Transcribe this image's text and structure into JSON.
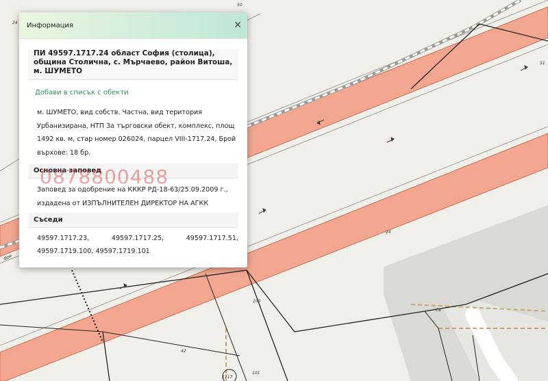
{
  "popup": {
    "title": "Информация",
    "close_icon": "close-icon",
    "parcel_title": "ПИ 49597.1717.24 област София (столица), община Столична, с. Мърчаево, район Витоша, м. ШУМЕТО",
    "add_link": "Добави в списък с обекти",
    "description_lines": [
      "м. ШУМЕТО, вид собств. Частна, вид територия",
      "Урбанизирана, НТП За търговски обект, комплекс, площ",
      "1492 кв. м, стар номер 026024, парцел VIII-1717.24, Брой",
      "върхове: 18 бр."
    ],
    "order_heading": "Основна заповед",
    "order_lines": [
      "Заповед за одобрение на КККР РД-18-63/25.09.2009 г.,",
      "издадена от ИЗПЪЛНИТЕЛЕН ДИРЕКТОР НА АГКК"
    ],
    "neighbors_heading": "Съседи",
    "neighbors_row1": [
      "49597.1717.23,",
      "49597.1717.25,",
      "49597.1717.51,"
    ],
    "neighbors_row2": "49597.1719.100, 49597.1719.101"
  },
  "watermark": "0878800488",
  "map": {
    "labels": [
      "50",
      "34",
      "51",
      "24",
      "100",
      "42",
      "101",
      "Св",
      "фре",
      "1717"
    ],
    "colors": {
      "background": "#f1efe9",
      "road_fill": "#f2a690",
      "road_edge": "#c96e55",
      "gray_area": "#d9d9d6",
      "dashed_boundary": "#c9a46a",
      "parcel_line": "#222222"
    }
  }
}
